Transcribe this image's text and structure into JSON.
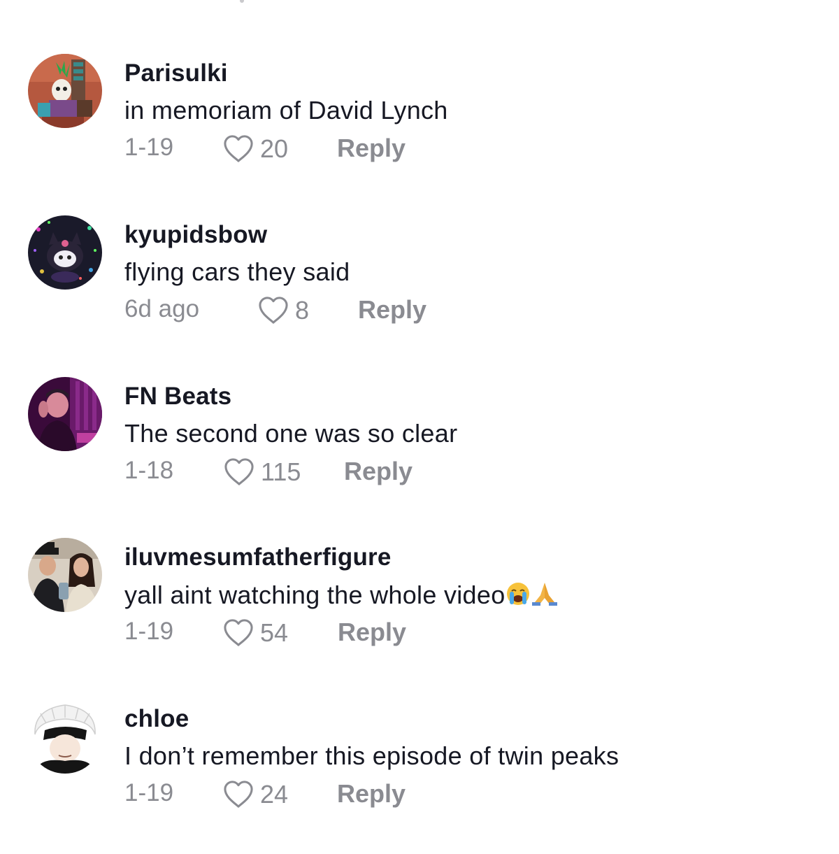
{
  "comments": [
    {
      "username": "Parisulki",
      "text": "in memoriam of David Lynch",
      "date": "1-19",
      "likes": "20",
      "reply_label": "Reply",
      "avatar_icon": "robot-character-avatar"
    },
    {
      "username": "kyupidsbow",
      "text": "flying cars they said",
      "date": "6d ago",
      "likes": "8",
      "reply_label": "Reply",
      "avatar_icon": "kuromi-plush-lights-avatar"
    },
    {
      "username": "FN Beats",
      "text": "The second one was so clear",
      "date": "1-18",
      "likes": "115",
      "reply_label": "Reply",
      "avatar_icon": "person-purple-light-avatar"
    },
    {
      "username": "iluvmesumfatherfigure",
      "text": "yall aint watching the whole video",
      "text_emojis": [
        "loudly-crying-face-emoji",
        "folded-hands-emoji"
      ],
      "date": "1-19",
      "likes": "54",
      "reply_label": "Reply",
      "avatar_icon": "couple-selfie-avatar"
    },
    {
      "username": "chloe",
      "text": "I don’t remember this episode of twin peaks",
      "date": "1-19",
      "likes": "24",
      "reply_label": "Reply",
      "avatar_icon": "anime-blindfold-character-avatar"
    }
  ],
  "colors": {
    "username": "#161823",
    "meta": "#8a8b91"
  }
}
